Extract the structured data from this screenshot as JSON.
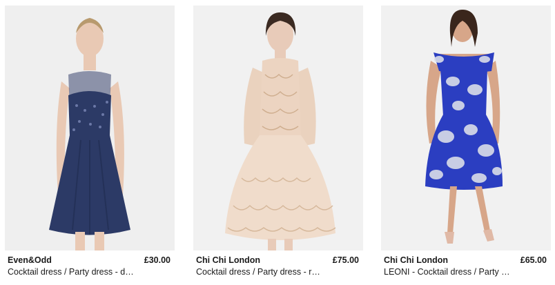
{
  "products": [
    {
      "brand": "Even&Odd",
      "price": "£30.00",
      "name": "Cocktail dress / Party dress - d…",
      "dress_color": "#2c3a66",
      "photo_alt": "Model wearing navy sequin party dress"
    },
    {
      "brand": "Chi Chi London",
      "price": "£75.00",
      "name": "Cocktail dress / Party dress - r…",
      "dress_color": "#ecd4c1",
      "photo_alt": "Model wearing blush lace party dress"
    },
    {
      "brand": "Chi Chi London",
      "price": "£65.00",
      "name": "LEONI - Cocktail dress / Party …",
      "dress_color": "#2b3ec1",
      "photo_alt": "Model wearing blue floral jacquard dress"
    }
  ]
}
